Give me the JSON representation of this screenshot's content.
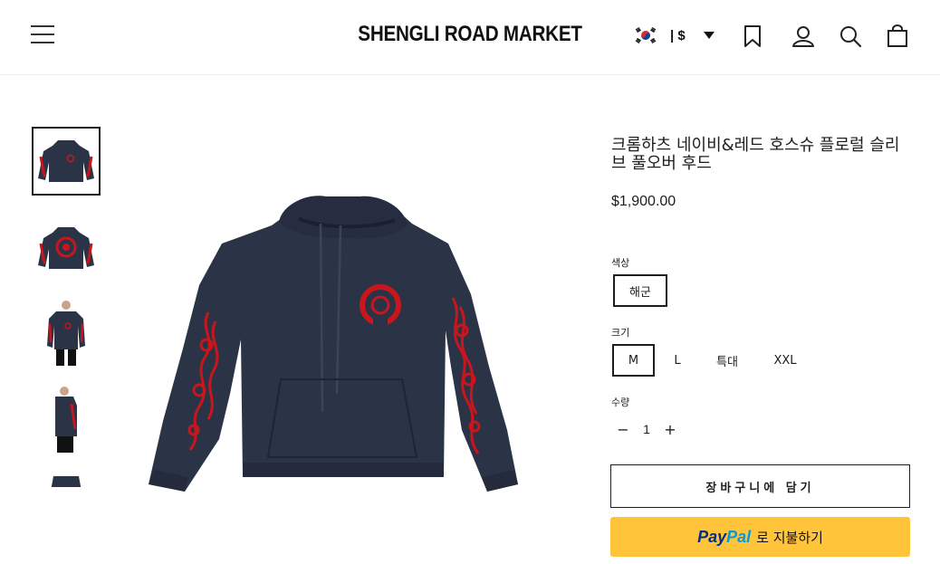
{
  "header": {
    "store_name": "SHENGLI ROAD MARKET",
    "currency": "| $"
  },
  "product": {
    "title": "크롬하츠 네이비&레드 호스슈 플로럴 슬리브 풀오버 후드",
    "price": "$1,900.00",
    "color_label": "색상",
    "color_options": [
      "해군"
    ],
    "size_label": "크기",
    "size_options": [
      "M",
      "L",
      "특대",
      "XXL"
    ],
    "selected_size": "M",
    "quantity_label": "수량",
    "quantity": "1",
    "quantity_minus": "−",
    "quantity_plus": "+",
    "add_to_cart": "장바구니에 담기",
    "paypal_pay": "Pay",
    "paypal_pal": "Pal",
    "paypal_suffix": "로 지불하기"
  },
  "colors": {
    "hoodie_navy": "#2b3347",
    "accent_red": "#c8161d",
    "paypal_yellow": "#ffc439",
    "paypal_dark_blue": "#003087",
    "paypal_light_blue": "#009cde"
  },
  "icons": [
    "menu-icon",
    "korea-flag-icon",
    "bookmark-icon",
    "account-icon",
    "search-icon",
    "cart-icon"
  ]
}
